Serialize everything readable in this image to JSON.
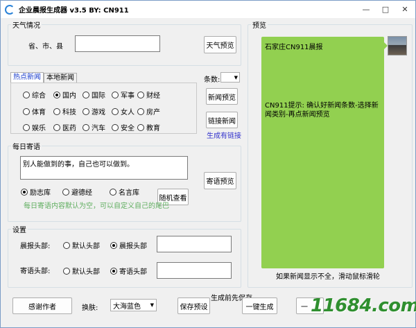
{
  "window": {
    "title": "企业晨报生成器 v3.5 BY:  CN911",
    "minimize": "—",
    "restore": "□",
    "close": "✕"
  },
  "weather": {
    "legend": "天气情况",
    "region_label": "省、市、县",
    "region_value": "",
    "preview_button": "天气预览"
  },
  "news": {
    "tabs": [
      "热点新闻",
      "本地新闻"
    ],
    "active_tab": 0,
    "count_label": "条数:",
    "count_value": "",
    "categories": [
      {
        "label": "综合",
        "selected": false
      },
      {
        "label": "国内",
        "selected": true
      },
      {
        "label": "国际",
        "selected": false
      },
      {
        "label": "军事",
        "selected": false
      },
      {
        "label": "财经",
        "selected": false
      },
      {
        "label": "体育",
        "selected": false
      },
      {
        "label": "科技",
        "selected": false
      },
      {
        "label": "游戏",
        "selected": false
      },
      {
        "label": "女人",
        "selected": false
      },
      {
        "label": "房产",
        "selected": false
      },
      {
        "label": "娱乐",
        "selected": false
      },
      {
        "label": "医药",
        "selected": false
      },
      {
        "label": "汽车",
        "selected": false
      },
      {
        "label": "安全",
        "selected": false
      },
      {
        "label": "教育",
        "selected": false
      }
    ],
    "preview_button": "新闻预览",
    "link_button": "链接新闻",
    "link_hint": "生成有链接",
    "link_hint_color": "#3333cc"
  },
  "daily": {
    "legend": "每日寄语",
    "text": "别人能做到的事，自己也可以做到。",
    "options": [
      {
        "label": "励志库",
        "selected": true
      },
      {
        "label": "避德经",
        "selected": false
      },
      {
        "label": "名言库",
        "selected": false
      }
    ],
    "random_button": "随机查看",
    "preview_button": "寄语预览",
    "hint": "每日寄语内容默认为空，可以自定义自己的尾巴",
    "hint_color": "#5fae5f"
  },
  "settings": {
    "legend": "设置",
    "rows": [
      {
        "label": "晨报头部:",
        "options": [
          {
            "label": "默认头部",
            "selected": false
          },
          {
            "label": "晨报头部",
            "selected": true
          }
        ],
        "value": ""
      },
      {
        "label": "寄语头部:",
        "options": [
          {
            "label": "默认头部",
            "selected": false
          },
          {
            "label": "寄语头部",
            "selected": true
          }
        ],
        "value": ""
      }
    ]
  },
  "preview": {
    "legend": "预览",
    "heading": "石家庄CN911晨报",
    "tip": "CN911提示: 确认好新闻条数-选择新闻类别-再点新闻预览",
    "scroll_hint": "如果新闻显示不全，滑动鼠标滑轮",
    "bubble_color": "#92d050"
  },
  "footer": {
    "thanks_button": "感谢作者",
    "skin_label": "换肤:",
    "skin_value": "大海蓝色",
    "save_hint": "生成前先保存",
    "save_button": "保存预设",
    "generate_button": "一键生成",
    "extra_button": "一",
    "logo_text": "11684.com"
  }
}
